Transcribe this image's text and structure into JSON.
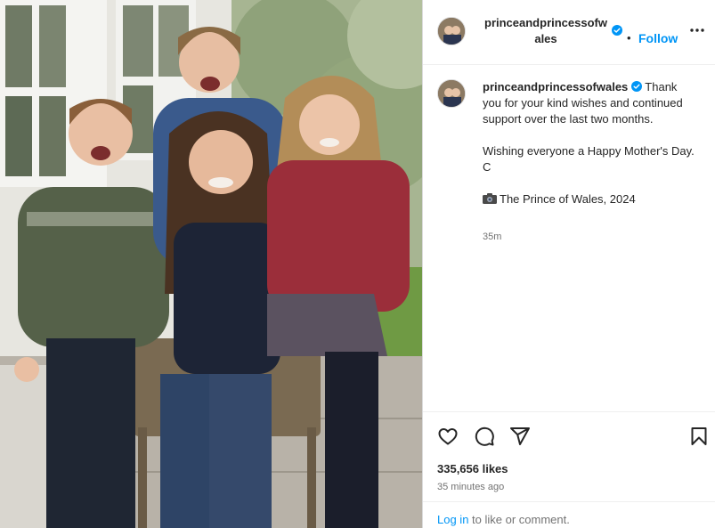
{
  "post": {
    "username": "princeandprincessofwales",
    "username_header_line1": "princeandprincessofw",
    "username_header_line2": "ales",
    "follow_dot": "•",
    "follow_label": "Follow",
    "more_icon": "more-horizontal-icon",
    "verified_icon": "verified-badge-icon",
    "caption": {
      "line1": "Thank you for your kind wishes and continued support over the last two months.",
      "line2": "Wishing everyone a Happy Mother's Day. C",
      "line3": "The Prince of Wales, 2024",
      "camera_icon": "camera-emoji-icon"
    },
    "caption_time": "35m",
    "likes": "335,656 likes",
    "posted": "35 minutes ago",
    "login_link": "Log in",
    "login_rest": " to like or comment."
  },
  "colors": {
    "accent": "#0095f6",
    "text": "#262626",
    "muted": "#737373",
    "border": "#dbdbdb"
  },
  "photo": {
    "subject": "Family portrait: mother seated on a wicker chair with three smiling children outdoors"
  }
}
